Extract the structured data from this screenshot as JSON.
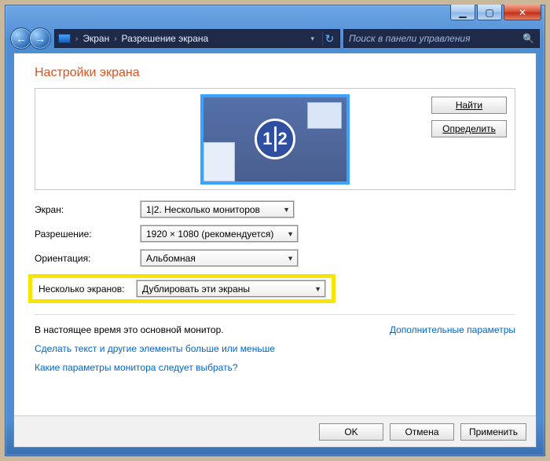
{
  "titlebar": {
    "minimize_glyph": "▁",
    "maximize_glyph": "▢",
    "close_glyph": "✕"
  },
  "nav": {
    "back_glyph": "←",
    "forward_glyph": "→",
    "crumb1": "Экран",
    "crumb2": "Разрешение экрана",
    "chevron": "›",
    "dropdown_glyph": "▾",
    "refresh_glyph": "↻"
  },
  "search": {
    "placeholder": "Поиск в панели управления",
    "icon_glyph": "🔍"
  },
  "heading": "Настройки экрана",
  "side_buttons": {
    "find": "Найти",
    "detect": "Определить"
  },
  "monitor_label_left": "1",
  "monitor_label_right": "2",
  "form": {
    "screen_label": "Экран:",
    "screen_value": "1|2. Несколько мониторов",
    "resolution_label": "Разрешение:",
    "resolution_value": "1920 × 1080 (рекомендуется)",
    "orientation_label": "Ориентация:",
    "orientation_value": "Альбомная",
    "multi_label": "Несколько экранов:",
    "multi_value": "Дублировать эти экраны"
  },
  "note_text": "В настоящее время это основной монитор.",
  "advanced_link": "Дополнительные параметры",
  "link1": "Сделать текст и другие элементы больше или меньше",
  "link2": "Какие параметры монитора следует выбрать?",
  "footer": {
    "ok": "OK",
    "cancel": "Отмена",
    "apply": "Применить"
  },
  "combo_arrow": "▼"
}
